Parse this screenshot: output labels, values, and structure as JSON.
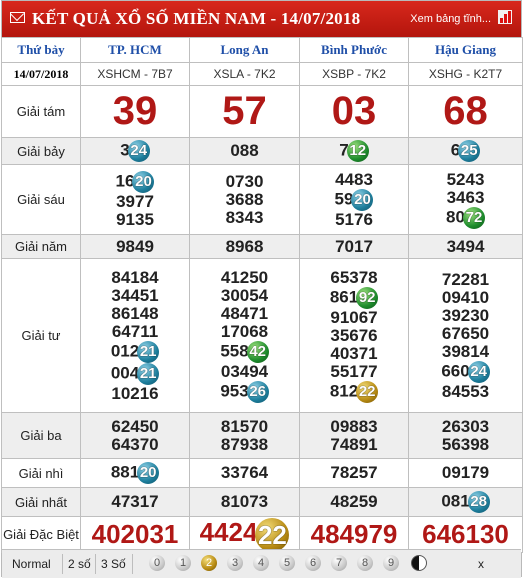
{
  "header": {
    "title": "KẾT QUẢ XỔ SỐ MIỀN NAM - 14/07/2018",
    "link": "Xem bảng tĩnh..."
  },
  "columns": {
    "day": "Thứ bảy",
    "date": "14/07/2018",
    "provinces": [
      {
        "name": "TP. HCM",
        "code": "XSHCM - 7B7"
      },
      {
        "name": "Long An",
        "code": "XSLA - 7K2"
      },
      {
        "name": "Bình Phước",
        "code": "XSBP - 7K2"
      },
      {
        "name": "Hậu Giang",
        "code": "XSHG - K2T7"
      }
    ]
  },
  "prizes": {
    "g8": {
      "label": "Giải tám",
      "values": [
        "39",
        "57",
        "03",
        "68"
      ]
    },
    "g7": {
      "label": "Giải bảy",
      "values": [
        [
          "3",
          "24"
        ],
        [
          "088",
          ""
        ],
        [
          "7",
          "12"
        ],
        [
          "6",
          "25"
        ]
      ]
    },
    "g6": {
      "label": "Giải sáu",
      "values": [
        [
          [
            "16",
            "20"
          ],
          [
            "3977",
            ""
          ],
          [
            "9135",
            ""
          ]
        ],
        [
          [
            "0730",
            ""
          ],
          [
            "3688",
            ""
          ],
          [
            "8343",
            ""
          ]
        ],
        [
          [
            "4483",
            ""
          ],
          [
            "59",
            "20"
          ],
          [
            "5176",
            ""
          ]
        ],
        [
          [
            "5243",
            ""
          ],
          [
            "3463",
            ""
          ],
          [
            "80",
            "72"
          ]
        ]
      ]
    },
    "g5": {
      "label": "Giải năm",
      "values": [
        "9849",
        "8968",
        "7017",
        "3494"
      ]
    },
    "g4": {
      "label": "Giải tư",
      "values": [
        [
          [
            "84184",
            ""
          ],
          [
            "34451",
            ""
          ],
          [
            "86148",
            ""
          ],
          [
            "64711",
            ""
          ],
          [
            "012",
            "21"
          ],
          [
            "004",
            "21"
          ],
          [
            "10216",
            ""
          ]
        ],
        [
          [
            "41250",
            ""
          ],
          [
            "30054",
            ""
          ],
          [
            "48471",
            ""
          ],
          [
            "17068",
            ""
          ],
          [
            "558",
            "42"
          ],
          [
            "03494",
            ""
          ],
          [
            "953",
            "26"
          ]
        ],
        [
          [
            "65378",
            ""
          ],
          [
            "861",
            "92"
          ],
          [
            "91067",
            ""
          ],
          [
            "35676",
            ""
          ],
          [
            "40371",
            ""
          ],
          [
            "55177",
            ""
          ],
          [
            "812",
            "22"
          ]
        ],
        [
          [
            "72281",
            ""
          ],
          [
            "09410",
            ""
          ],
          [
            "39230",
            ""
          ],
          [
            "67650",
            ""
          ],
          [
            "39814",
            ""
          ],
          [
            "660",
            "24"
          ],
          [
            "84553",
            ""
          ]
        ]
      ]
    },
    "g3": {
      "label": "Giải ba",
      "values": [
        [
          "62450",
          "64370"
        ],
        [
          "81570",
          "87938"
        ],
        [
          "09883",
          "74891"
        ],
        [
          "26303",
          "56398"
        ]
      ]
    },
    "g2": {
      "label": "Giải nhì",
      "values": [
        [
          "881",
          "20"
        ],
        [
          "33764",
          ""
        ],
        [
          "78257",
          ""
        ],
        [
          "09179",
          ""
        ]
      ]
    },
    "g1": {
      "label": "Giải nhất",
      "values": [
        [
          "47317",
          ""
        ],
        [
          "81073",
          ""
        ],
        [
          "48259",
          ""
        ],
        [
          "081",
          "28"
        ]
      ]
    },
    "db": {
      "label": "Giải Đặc Biệt",
      "values": [
        [
          "402031",
          ""
        ],
        [
          "4424",
          "22"
        ],
        [
          "484979",
          ""
        ],
        [
          "646130",
          ""
        ]
      ]
    }
  },
  "ball_colors": {
    "b1": "#1d7e9c",
    "b2": "#1d8c2c",
    "b3": "#b78a12"
  },
  "toolbar": {
    "normal": "Normal",
    "two": "2 số",
    "three": "3 Số",
    "digits": [
      "0",
      "1",
      "2",
      "3",
      "4",
      "5",
      "6",
      "7",
      "8",
      "9"
    ],
    "active_digit": "2",
    "close": "x"
  }
}
